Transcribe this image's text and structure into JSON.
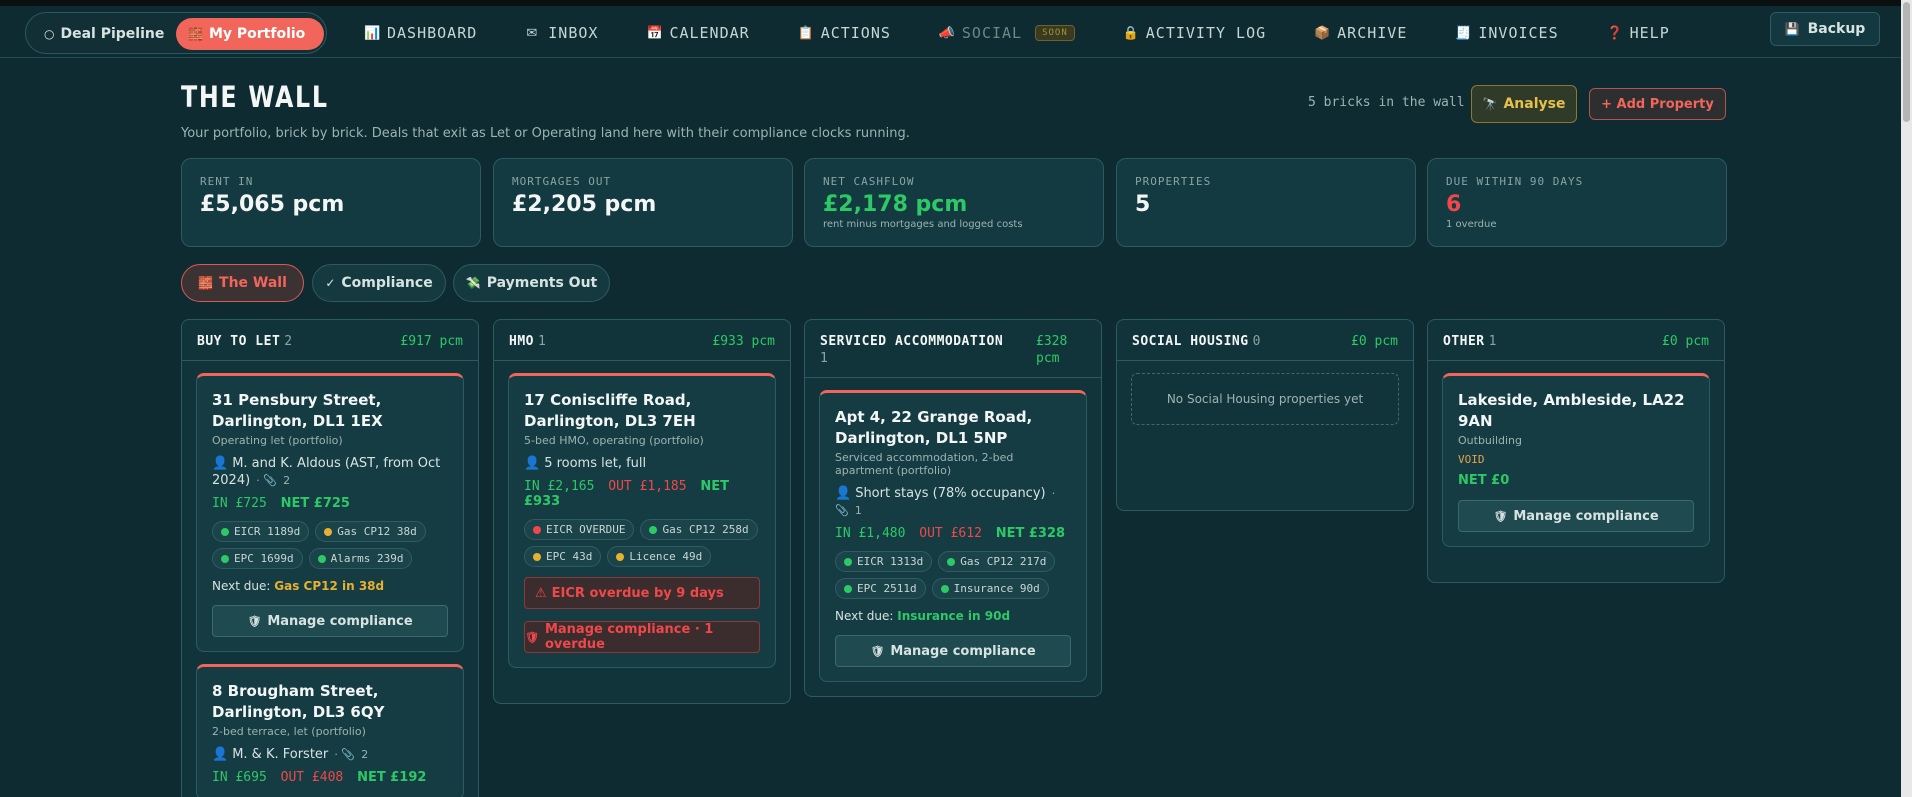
{
  "nav": {
    "deal_pipeline": "Deal Pipeline",
    "my_portfolio": "My Portfolio",
    "links": [
      {
        "label": "DASHBOARD",
        "icon": "📊"
      },
      {
        "label": "INBOX",
        "icon": "✉"
      },
      {
        "label": "CALENDAR",
        "icon": "📅"
      },
      {
        "label": "ACTIONS",
        "icon": "📋"
      },
      {
        "label": "SOCIAL",
        "icon": "📣",
        "badge": "SOON"
      },
      {
        "label": "ACTIVITY LOG",
        "icon": "🔒"
      },
      {
        "label": "ARCHIVE",
        "icon": "📦"
      },
      {
        "label": "INVOICES",
        "icon": "🧾"
      },
      {
        "label": "HELP",
        "icon": "❓"
      }
    ],
    "backup": "Backup"
  },
  "header": {
    "title": "THE WALL",
    "subtitle": "Your portfolio, brick by brick. Deals that exit as Let or Operating land here with their compliance clocks running.",
    "brick_count": "5 bricks in the wall",
    "analyse": "Analyse",
    "add_property": "+ Add Property"
  },
  "stats": [
    {
      "label": "RENT IN",
      "value": "£5,065 pcm",
      "note": ""
    },
    {
      "label": "MORTGAGES OUT",
      "value": "£2,205 pcm",
      "note": ""
    },
    {
      "label": "NET CASHFLOW",
      "value": "£2,178 pcm",
      "note": "rent minus mortgages and logged costs"
    },
    {
      "label": "PROPERTIES",
      "value": "5",
      "note": ""
    },
    {
      "label": "DUE WITHIN 90 DAYS",
      "value": "6",
      "note": "1 overdue"
    }
  ],
  "tabs": [
    "The Wall",
    "Compliance",
    "Payments Out"
  ],
  "colors": {
    "accent": "#f2655a",
    "green": "#2ec866",
    "red": "#f0484a",
    "amber": "#e8b030",
    "bg": "#0d2b31"
  },
  "columns": [
    {
      "title": "BUY TO LET",
      "count": "2",
      "total": "£917 pcm"
    },
    {
      "title": "HMO",
      "count": "1",
      "total": "£933 pcm"
    },
    {
      "title": "SERVICED ACCOMMODATION",
      "count": "1",
      "total": "£328 pcm"
    },
    {
      "title": "SOCIAL HOUSING",
      "count": "0",
      "total": "£0 pcm",
      "empty": "No Social Housing properties yet"
    },
    {
      "title": "OTHER",
      "count": "1",
      "total": "£0 pcm"
    }
  ],
  "cards": {
    "pensbury": {
      "address": "31 Pensbury Street, Darlington, DL1 1EX",
      "desc": "Operating let (portfolio)",
      "tenant": "M. and K. Aldous (AST, from Oct 2024)",
      "docs": "2",
      "in": "IN £725",
      "net": "NET £725",
      "chips": [
        "EICR 1189d",
        "Gas CP12 38d",
        "EPC 1699d",
        "Alarms 239d"
      ],
      "next_label": "Next due:",
      "next_value": "Gas CP12 in 38d",
      "manage": "Manage compliance"
    },
    "brougham": {
      "address": "8 Brougham Street, Darlington, DL3 6QY",
      "desc": "2-bed terrace, let (portfolio)",
      "tenant": "M. & K. Forster",
      "docs": "2",
      "in": "IN £695",
      "out": "OUT £408",
      "net": "NET £192"
    },
    "conscliffe": {
      "address": "17 Coniscliffe Road, Darlington, DL3 7EH",
      "desc": "5-bed HMO, operating (portfolio)",
      "tenant": "5 rooms let, full",
      "in": "IN £2,165",
      "out": "OUT £1,185",
      "net": "NET £933",
      "chips": [
        "EICR OVERDUE",
        "Gas CP12 258d",
        "EPC 43d",
        "Licence 49d"
      ],
      "alert": "EICR overdue by 9 days",
      "manage": "Manage compliance · 1 overdue"
    },
    "grange": {
      "address": "Apt 4, 22 Grange Road, Darlington, DL1 5NP",
      "desc": "Serviced accommodation, 2-bed apartment (portfolio)",
      "tenant": "Short stays (78% occupancy)",
      "docs": "1",
      "in": "IN £1,480",
      "out": "OUT £612",
      "net": "NET £328",
      "chips": [
        "EICR 1313d",
        "Gas CP12 217d",
        "EPC 2511d",
        "Insurance 90d"
      ],
      "next_label": "Next due:",
      "next_value": "Insurance in 90d",
      "manage": "Manage compliance"
    },
    "lakeside": {
      "address": "Lakeside, Ambleside, LA22 9AN",
      "desc": "Outbuilding",
      "status": "VOID",
      "net": "NET £0",
      "manage": "Manage compliance"
    }
  }
}
